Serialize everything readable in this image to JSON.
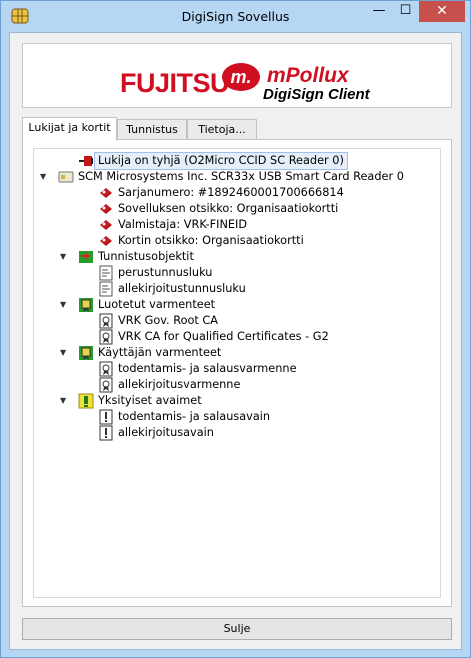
{
  "window": {
    "title": "DigiSign Sovellus",
    "minimize_glyph": "—",
    "maximize_glyph": "☐",
    "close_glyph": "✕",
    "app_icon": "smart-card-chip-icon"
  },
  "banner": {
    "brand": "FUJITSU",
    "mark_letter": "m.",
    "product": "mPollux",
    "subtitle": "DigiSign Client",
    "brand_color": "#d01020"
  },
  "tabs": [
    {
      "label": "Lukijat ja kortit",
      "active": true
    },
    {
      "label": "Tunnistus",
      "active": false
    },
    {
      "label": "Tietoja...",
      "active": false
    }
  ],
  "tree": {
    "nodes": [
      {
        "text": "Lukija on tyhjä (O2Micro CCID SC Reader 0)",
        "icon": "empty-reader-icon",
        "selected": true
      },
      {
        "text": "SCM Microsystems Inc. SCR33x USB Smart Card Reader 0",
        "icon": "card-reader-icon",
        "expanded": true
      },
      {
        "text": "Sarjanumero: #1892460001700666814",
        "icon": "property-icon"
      },
      {
        "text": "Sovelluksen otsikko: Organisaatiokortti",
        "icon": "property-icon"
      },
      {
        "text": "Valmistaja: VRK-FINEID",
        "icon": "property-icon"
      },
      {
        "text": "Kortin otsikko: Organisaatiokortti",
        "icon": "property-icon"
      },
      {
        "text": "Tunnistusobjektit",
        "icon": "auth-objects-folder-icon",
        "expanded": true
      },
      {
        "text": "perustunnusluku",
        "icon": "pin-object-icon"
      },
      {
        "text": "allekirjoitustunnusluku",
        "icon": "pin-object-icon"
      },
      {
        "text": "Luotetut varmenteet",
        "icon": "trusted-certs-folder-icon",
        "expanded": true
      },
      {
        "text": "VRK Gov. Root CA",
        "icon": "certificate-icon"
      },
      {
        "text": "VRK CA for Qualified Certificates - G2",
        "icon": "certificate-icon"
      },
      {
        "text": "Käyttäjän varmenteet",
        "icon": "user-certs-folder-icon",
        "expanded": true
      },
      {
        "text": "todentamis- ja salausvarmenne",
        "icon": "certificate-icon"
      },
      {
        "text": "allekirjoitusvarmenne",
        "icon": "certificate-icon"
      },
      {
        "text": "Yksityiset avaimet",
        "icon": "private-keys-folder-icon",
        "expanded": true
      },
      {
        "text": "todentamis- ja salausavain",
        "icon": "private-key-icon"
      },
      {
        "text": "allekirjoitusavain",
        "icon": "private-key-icon"
      }
    ]
  },
  "footer": {
    "close_label": "Sulje"
  }
}
